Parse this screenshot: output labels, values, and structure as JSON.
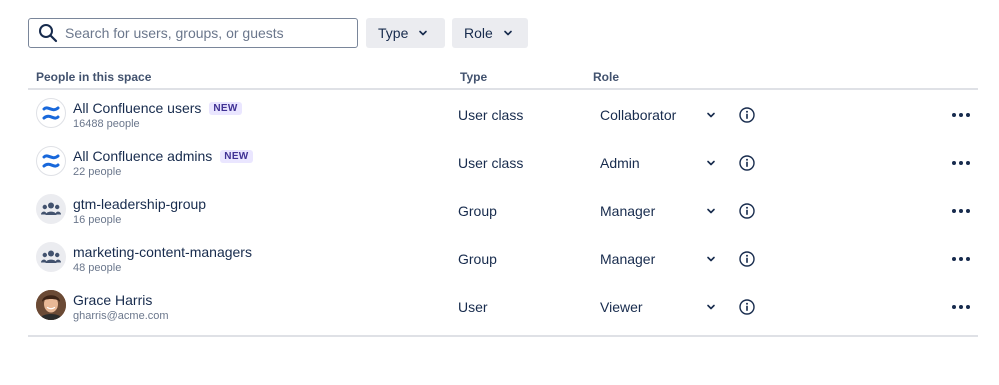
{
  "search": {
    "placeholder": "Search for users, groups, or guests",
    "value": ""
  },
  "filters": {
    "type_label": "Type",
    "role_label": "Role"
  },
  "table": {
    "headers": {
      "people": "People in this space",
      "type": "Type",
      "role": "Role"
    },
    "rows": [
      {
        "name": "All Confluence users",
        "badge": "NEW",
        "sub": "16488 people",
        "type": "User class",
        "role": "Collaborator",
        "avatar": "confluence-logo"
      },
      {
        "name": "All Confluence admins",
        "badge": "NEW",
        "sub": "22 people",
        "type": "User class",
        "role": "Admin",
        "avatar": "confluence-logo"
      },
      {
        "name": "gtm-leadership-group",
        "badge": "",
        "sub": "16 people",
        "type": "Group",
        "role": "Manager",
        "avatar": "group-icon"
      },
      {
        "name": "marketing-content-managers",
        "badge": "",
        "sub": "48 people",
        "type": "Group",
        "role": "Manager",
        "avatar": "group-icon"
      },
      {
        "name": "Grace Harris",
        "badge": "",
        "sub": "gharris@acme.com",
        "type": "User",
        "role": "Viewer",
        "avatar": "user-photo"
      }
    ]
  },
  "colors": {
    "confluence_blue": "#1868db",
    "badge_bg": "#eae6ff",
    "badge_text": "#403294",
    "divider": "#dfe1e6"
  }
}
